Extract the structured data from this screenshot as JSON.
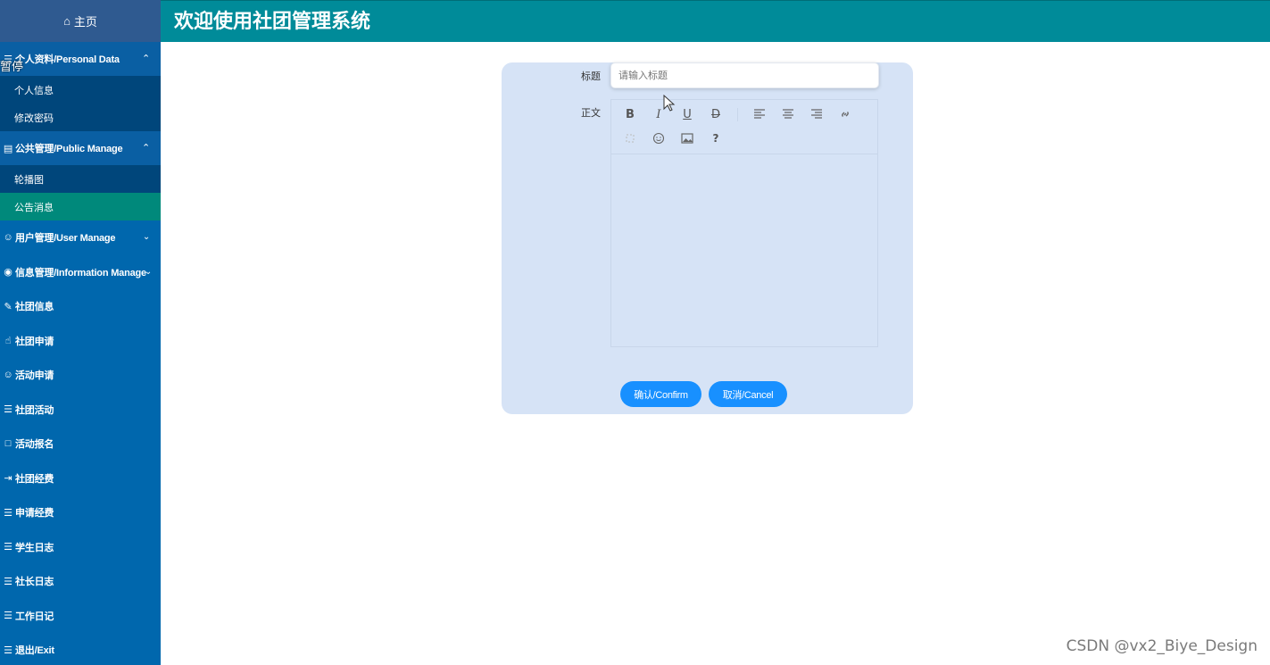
{
  "sidebar": {
    "home_label": "主页",
    "groups": [
      {
        "label": "个人资料/Personal Data",
        "items": [
          "个人信息",
          "修改密码"
        ]
      },
      {
        "label": "公共管理/Public Manage",
        "items": [
          "轮播图",
          "公告消息"
        ]
      }
    ],
    "menus": [
      "用户管理/User Manage",
      "信息管理/Information Manage",
      "社团信息",
      "社团申请",
      "活动申请",
      "社团活动",
      "活动报名",
      "社团经费",
      "申请经费",
      "学生日志",
      "社长日志",
      "工作日记",
      "退出/Exit"
    ],
    "pause_label": "暂停"
  },
  "header": {
    "title": "欢迎使用社团管理系统"
  },
  "form": {
    "title_label": "标题",
    "title_placeholder": "请输入标题",
    "body_label": "正文",
    "toolbar_icons": [
      "bold-icon",
      "italic-icon",
      "underline-icon",
      "strikethrough-icon",
      "align-left-icon",
      "align-center-icon",
      "align-right-icon",
      "link-icon",
      "unlink-icon",
      "emoji-icon",
      "image-icon",
      "help-icon"
    ],
    "confirm_label": "确认/Confirm",
    "cancel_label": "取消/Cancel"
  },
  "watermark": "CSDN @vx2_Biye_Design",
  "colors": {
    "sidebar": "#0067ad",
    "header": "#008b99",
    "active_item": "#00897b",
    "button": "#1890ff",
    "card": "#d6e3f6"
  }
}
